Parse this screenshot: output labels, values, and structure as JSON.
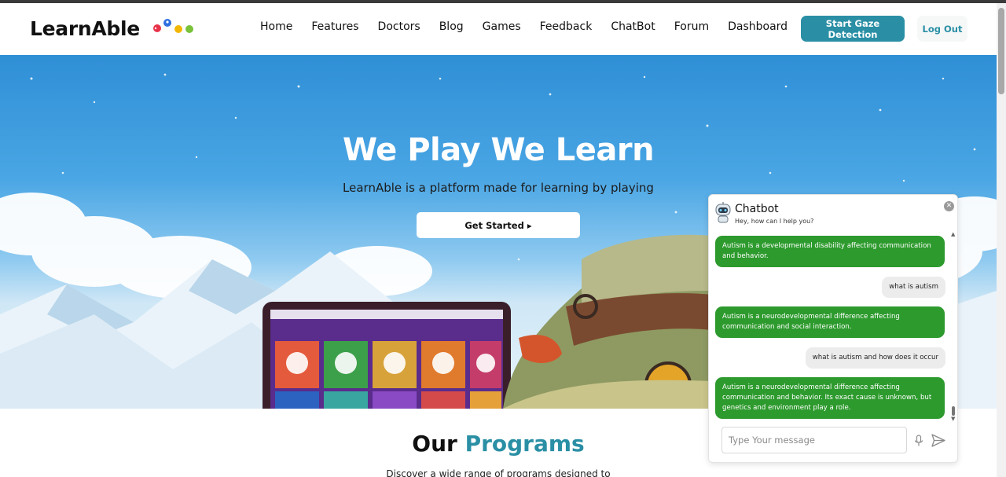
{
  "brand": {
    "name": "LearnAble",
    "logo_colors": [
      "#e8334a",
      "#2f6fe0",
      "#f2b705",
      "#79c23a"
    ]
  },
  "nav": {
    "links": [
      "Home",
      "Features",
      "Doctors",
      "Blog",
      "Games",
      "Feedback",
      "ChatBot",
      "Forum",
      "Dashboard"
    ],
    "gaze_button": "Start Gaze Detection",
    "logout_button": "Log Out"
  },
  "hero": {
    "title": "We Play We Learn",
    "subtitle": "LearnAble is a platform made for learning by playing",
    "cta": "Get Started ▸"
  },
  "programs": {
    "title_part1": "Our ",
    "title_part2": "Programs",
    "description": "Discover a wide range of programs designed to"
  },
  "chatbot": {
    "title": "Chatbot",
    "subtitle": "Hey, how can I help you?",
    "close_icon": "close-icon",
    "messages": [
      {
        "role": "bot",
        "text": "Autism is a developmental disability affecting communication and behavior."
      },
      {
        "role": "user",
        "text": "what is autism"
      },
      {
        "role": "bot",
        "text": "Autism is a neurodevelopmental difference affecting communication and social interaction."
      },
      {
        "role": "user",
        "text": "what is autism and how does it occur"
      },
      {
        "role": "bot",
        "text": "Autism is a neurodevelopmental difference affecting communication and behavior. Its exact cause is unknown, but genetics and environment play a role."
      }
    ],
    "input_placeholder": "Type Your message",
    "mic_icon": "microphone-icon",
    "send_icon": "send-icon"
  },
  "colors": {
    "accent": "#2a8fa5",
    "bot_bubble": "#2d9a2d",
    "user_bubble": "#ececec"
  }
}
